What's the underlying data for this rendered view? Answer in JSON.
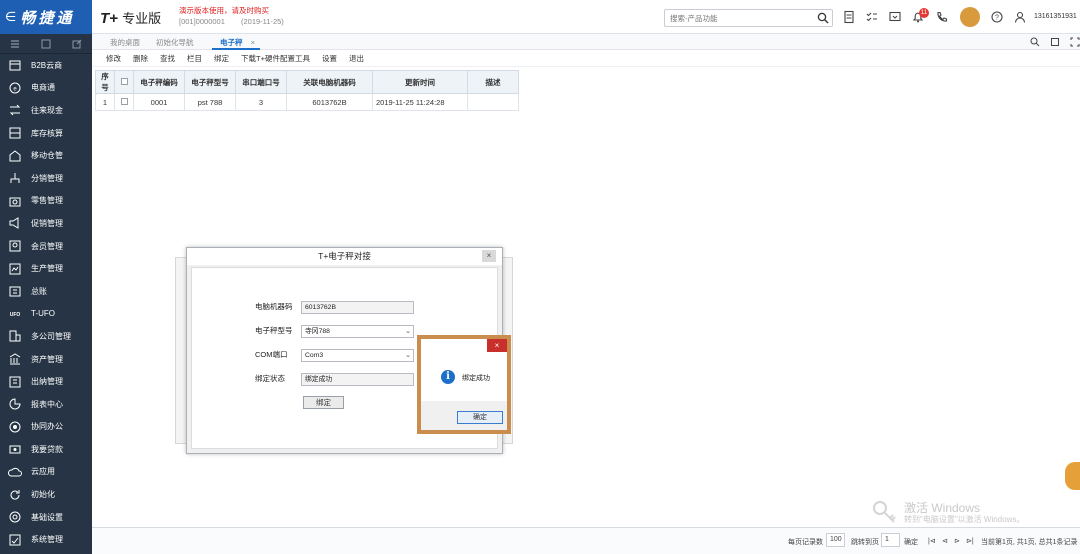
{
  "header": {
    "brand_arrow": "∈",
    "brand_name": "畅捷通",
    "product": "T+",
    "product_sub": "专业版",
    "demo_notice": "演示版本使用，请及时购买",
    "account_code": "[001]0000001",
    "account_date": "(2019-11-25)",
    "search_placeholder": "搜索-产品功能",
    "notification_count": "11",
    "phone": "13161351931"
  },
  "sidebar": {
    "items": [
      {
        "label": "B2B云商",
        "icon": "store-icon"
      },
      {
        "label": "电商通",
        "icon": "ecommerce-icon"
      },
      {
        "label": "往来现金",
        "icon": "exchange-icon"
      },
      {
        "label": "库存核算",
        "icon": "inventory-icon"
      },
      {
        "label": "移动仓管",
        "icon": "mobile-warehouse-icon"
      },
      {
        "label": "分销管理",
        "icon": "distribution-icon"
      },
      {
        "label": "零售管理",
        "icon": "retail-icon"
      },
      {
        "label": "促销管理",
        "icon": "promotion-icon"
      },
      {
        "label": "会员管理",
        "icon": "member-icon"
      },
      {
        "label": "生产管理",
        "icon": "production-icon"
      },
      {
        "label": "总账",
        "icon": "ledger-icon"
      },
      {
        "label": "T-UFO",
        "icon": "ufo-icon"
      },
      {
        "label": "多公司管理",
        "icon": "multi-company-icon"
      },
      {
        "label": "资产管理",
        "icon": "asset-icon"
      },
      {
        "label": "出纳管理",
        "icon": "cashier-icon"
      },
      {
        "label": "报表中心",
        "icon": "report-icon"
      },
      {
        "label": "协同办公",
        "icon": "collaboration-icon"
      },
      {
        "label": "我要贷款",
        "icon": "loan-icon"
      },
      {
        "label": "云应用",
        "icon": "cloud-icon"
      },
      {
        "label": "初始化",
        "icon": "init-icon"
      },
      {
        "label": "基础设置",
        "icon": "settings-icon"
      },
      {
        "label": "系统管理",
        "icon": "system-icon"
      }
    ]
  },
  "tabs": [
    {
      "label": "我的桌面"
    },
    {
      "label": "初始化导航"
    },
    {
      "label": "电子秤",
      "close": "×"
    }
  ],
  "toolbar": [
    "修改",
    "删除",
    "查找",
    "栏目",
    "绑定",
    "下载T+硬件配置工具",
    "设置",
    "退出"
  ],
  "table": {
    "headers": [
      "序号",
      "",
      "电子秤编码",
      "电子秤型号",
      "串口端口号",
      "关联电脑机器码",
      "更新时间",
      "描述"
    ],
    "rows": [
      [
        "1",
        "",
        "0001",
        "pst 788",
        "3",
        "6013762B",
        "2019-11-25 11:24:28",
        ""
      ]
    ]
  },
  "dialog": {
    "title": "T+电子秤对接",
    "close": "×",
    "fields": [
      {
        "label": "电脑机器码",
        "value": "6013762B"
      },
      {
        "label": "电子秤型号",
        "value": "寺冈788"
      },
      {
        "label": "COM端口",
        "value": "Com3"
      },
      {
        "label": "绑定状态",
        "value": "绑定成功"
      }
    ],
    "bind_button": "绑定"
  },
  "message": {
    "text": "绑定成功",
    "ok": "确定",
    "close": "×"
  },
  "pager": {
    "per_page_label": "每页记录数",
    "per_page": "100",
    "jump_label": "跳转到页",
    "jump_page": "1",
    "confirm": "确定",
    "info": "当前第1页, 共1页, 总共1条记录"
  },
  "watermark": {
    "line1": "激活 Windows",
    "line2": "转到\"电脑设置\"以激活 Windows。"
  },
  "colors": {
    "brand": "#1e5fb3",
    "sidebar": "#263445",
    "accent": "#1e6fc8",
    "demo": "#e02020"
  }
}
